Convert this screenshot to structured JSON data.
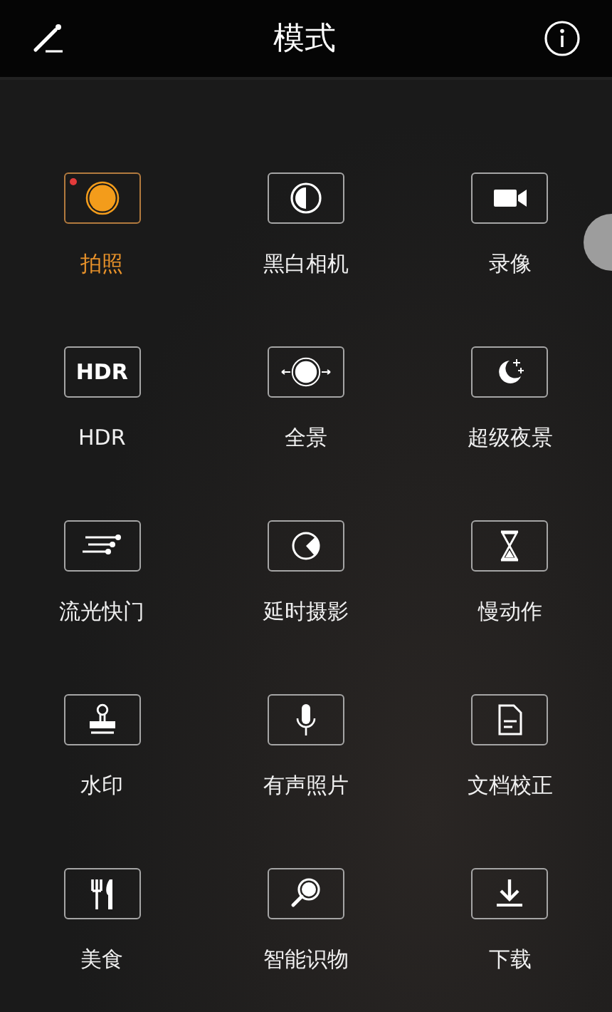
{
  "header": {
    "title": "模式"
  },
  "modes": [
    {
      "label": "拍照",
      "kind": "camera",
      "selected": true,
      "badge": true
    },
    {
      "label": "黑白相机",
      "kind": "mono",
      "selected": false,
      "badge": false
    },
    {
      "label": "录像",
      "kind": "video",
      "selected": false,
      "badge": false
    },
    {
      "label": "HDR",
      "kind": "hdr",
      "icon_text": "HDR",
      "selected": false,
      "badge": false
    },
    {
      "label": "全景",
      "kind": "panorama",
      "selected": false,
      "badge": false
    },
    {
      "label": "超级夜景",
      "kind": "night",
      "selected": false,
      "badge": false
    },
    {
      "label": "流光快门",
      "kind": "trails",
      "selected": false,
      "badge": false
    },
    {
      "label": "延时摄影",
      "kind": "timelapse",
      "selected": false,
      "badge": false
    },
    {
      "label": "慢动作",
      "kind": "slowmo",
      "selected": false,
      "badge": false
    },
    {
      "label": "水印",
      "kind": "stamp",
      "selected": false,
      "badge": false
    },
    {
      "label": "有声照片",
      "kind": "mic",
      "selected": false,
      "badge": false
    },
    {
      "label": "文档校正",
      "kind": "document",
      "selected": false,
      "badge": false
    },
    {
      "label": "美食",
      "kind": "food",
      "selected": false,
      "badge": false
    },
    {
      "label": "智能识物",
      "kind": "magnifier",
      "selected": false,
      "badge": false
    },
    {
      "label": "下载",
      "kind": "download",
      "selected": false,
      "badge": false
    }
  ]
}
